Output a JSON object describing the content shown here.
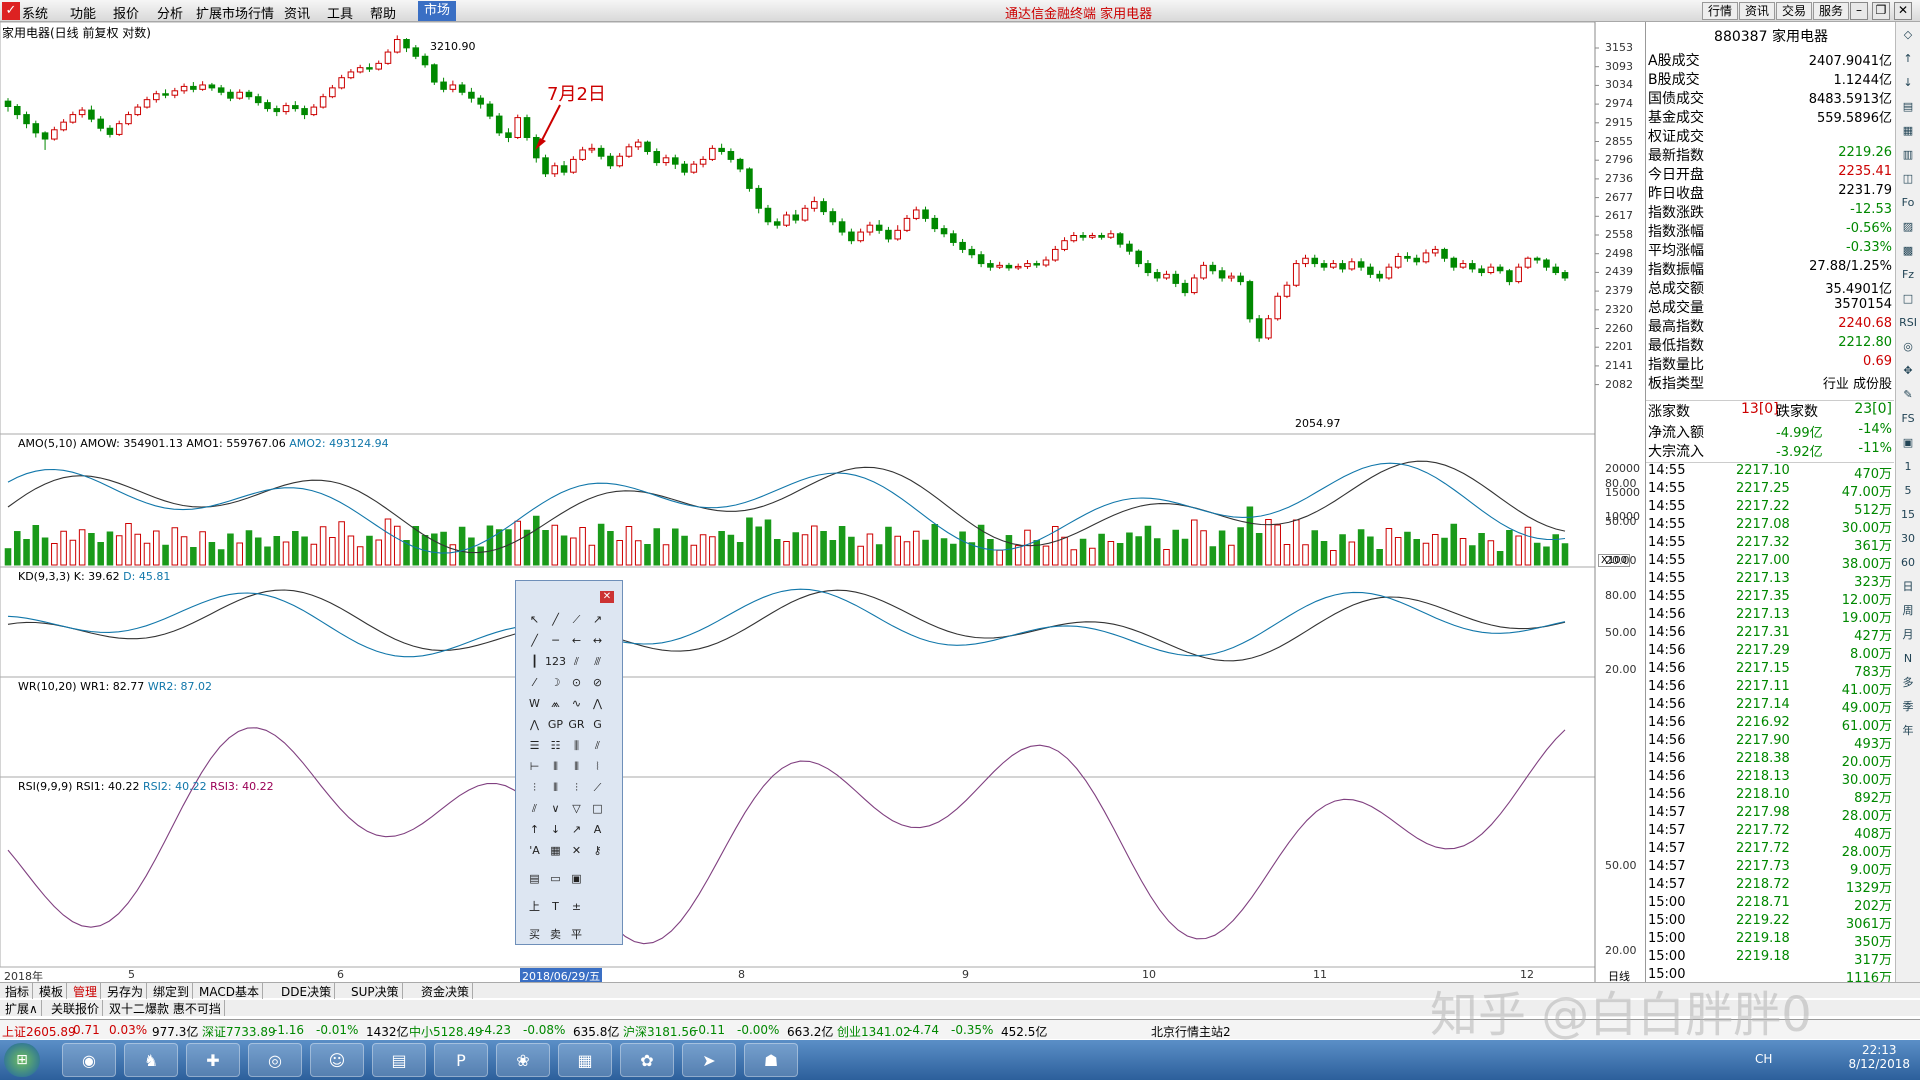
{
  "menubar": {
    "items": [
      "系统",
      "功能",
      "报价",
      "分析",
      "扩展市场行情",
      "资讯",
      "工具",
      "帮助"
    ],
    "active": "市场",
    "title": "通达信金融终端 家用电器",
    "right_buttons": [
      "行情",
      "资讯",
      "交易",
      "服务"
    ]
  },
  "chart": {
    "header": "家用电器(日线 前复权 对数)",
    "annotation": "7月2日",
    "high_label": "3210.90",
    "low_label": "2054.97",
    "y_ticks": [
      "3153",
      "3093",
      "3034",
      "2974",
      "2915",
      "2855",
      "2796",
      "2736",
      "2677",
      "2617",
      "2558",
      "2498",
      "2439",
      "2379",
      "2320",
      "2260",
      "2201",
      "2141",
      "2082"
    ],
    "amo_header": "AMO(5,10) AMOW: 354901.13 AMO1: 559767.06",
    "amo2": "AMO2: 493124.94",
    "amo_ticks": [
      "20000",
      "15000",
      "10000"
    ],
    "amo_unit": "X100",
    "kd_header": "KD(9,3,3) K: 39.62",
    "kd_d": "D: 45.81",
    "wr_header": "WR(10,20) WR1: 82.77",
    "wr_2": "WR2: 87.02",
    "rsi_header": "RSI(9,9,9) RSI1: 40.22",
    "rsi_2": "RSI2: 40.22",
    "rsi_3": "RSI3: 40.22",
    "osc_ticks": [
      "80.00",
      "50.00",
      "20.00"
    ],
    "rsi_ticks": [
      "50.00",
      "20.00"
    ],
    "x_labels": [
      "2018年",
      "5",
      "6",
      "2018/06/29/五",
      "8",
      "9",
      "10",
      "11",
      "12"
    ],
    "period": "日线"
  },
  "candle_data": [
    [
      2980,
      2962,
      2990,
      2945
    ],
    [
      2962,
      2935,
      2970,
      2920
    ],
    [
      2935,
      2905,
      2945,
      2890
    ],
    [
      2905,
      2875,
      2915,
      2860
    ],
    [
      2875,
      2855,
      2880,
      2820
    ],
    [
      2855,
      2885,
      2895,
      2850
    ],
    [
      2885,
      2910,
      2920,
      2880
    ],
    [
      2910,
      2935,
      2945,
      2905
    ],
    [
      2935,
      2950,
      2960,
      2925
    ],
    [
      2950,
      2920,
      2965,
      2910
    ],
    [
      2920,
      2890,
      2930,
      2880
    ],
    [
      2890,
      2870,
      2900,
      2860
    ],
    [
      2870,
      2905,
      2915,
      2865
    ],
    [
      2905,
      2935,
      2945,
      2900
    ],
    [
      2935,
      2960,
      2970,
      2930
    ],
    [
      2960,
      2985,
      2995,
      2955
    ],
    [
      2985,
      3005,
      3015,
      2975
    ],
    [
      3005,
      3000,
      3020,
      2990
    ],
    [
      3000,
      3015,
      3025,
      2990
    ],
    [
      3015,
      3030,
      3040,
      3005
    ],
    [
      3030,
      3020,
      3045,
      3010
    ],
    [
      3020,
      3035,
      3048,
      3015
    ],
    [
      3035,
      3025,
      3042,
      3015
    ],
    [
      3025,
      3010,
      3035,
      3000
    ],
    [
      3010,
      2990,
      3020,
      2980
    ],
    [
      2990,
      3010,
      3020,
      2985
    ],
    [
      3010,
      2995,
      3018,
      2985
    ],
    [
      2995,
      2975,
      3005,
      2965
    ],
    [
      2975,
      2955,
      2985,
      2945
    ],
    [
      2955,
      2945,
      2965,
      2930
    ],
    [
      2945,
      2965,
      2975,
      2935
    ],
    [
      2965,
      2955,
      2980,
      2945
    ],
    [
      2955,
      2935,
      2965,
      2920
    ],
    [
      2935,
      2960,
      2970,
      2930
    ],
    [
      2960,
      2995,
      3005,
      2955
    ],
    [
      2995,
      3025,
      3035,
      2990
    ],
    [
      3025,
      3060,
      3070,
      3020
    ],
    [
      3060,
      3080,
      3090,
      3055
    ],
    [
      3080,
      3095,
      3105,
      3075
    ],
    [
      3095,
      3090,
      3110,
      3080
    ],
    [
      3090,
      3110,
      3120,
      3085
    ],
    [
      3110,
      3150,
      3160,
      3105
    ],
    [
      3150,
      3195,
      3210,
      3145
    ],
    [
      3195,
      3165,
      3200,
      3150
    ],
    [
      3165,
      3135,
      3175,
      3125
    ],
    [
      3135,
      3105,
      3145,
      3095
    ],
    [
      3105,
      3045,
      3110,
      3035
    ],
    [
      3045,
      3020,
      3060,
      3010
    ],
    [
      3020,
      3035,
      3050,
      3010
    ],
    [
      3035,
      3010,
      3045,
      3000
    ],
    [
      3010,
      2990,
      3025,
      2975
    ],
    [
      2990,
      2970,
      3000,
      2955
    ],
    [
      2970,
      2930,
      2980,
      2920
    ],
    [
      2930,
      2875,
      2940,
      2865
    ],
    [
      2875,
      2860,
      2890,
      2845
    ],
    [
      2860,
      2925,
      2935,
      2855
    ],
    [
      2925,
      2860,
      2935,
      2850
    ],
    [
      2860,
      2795,
      2870,
      2780
    ],
    [
      2795,
      2745,
      2805,
      2735
    ],
    [
      2745,
      2770,
      2780,
      2735
    ],
    [
      2770,
      2750,
      2785,
      2740
    ],
    [
      2750,
      2790,
      2800,
      2745
    ],
    [
      2790,
      2820,
      2830,
      2785
    ],
    [
      2820,
      2825,
      2840,
      2810
    ],
    [
      2825,
      2800,
      2835,
      2790
    ],
    [
      2800,
      2770,
      2810,
      2760
    ],
    [
      2770,
      2800,
      2810,
      2765
    ],
    [
      2800,
      2830,
      2840,
      2795
    ],
    [
      2830,
      2845,
      2855,
      2820
    ],
    [
      2845,
      2815,
      2850,
      2805
    ],
    [
      2815,
      2780,
      2825,
      2770
    ],
    [
      2780,
      2795,
      2805,
      2770
    ],
    [
      2795,
      2775,
      2805,
      2760
    ],
    [
      2775,
      2750,
      2785,
      2740
    ],
    [
      2750,
      2775,
      2785,
      2745
    ],
    [
      2775,
      2790,
      2800,
      2765
    ],
    [
      2790,
      2825,
      2835,
      2785
    ],
    [
      2825,
      2815,
      2840,
      2805
    ],
    [
      2815,
      2790,
      2825,
      2780
    ],
    [
      2790,
      2760,
      2795,
      2750
    ],
    [
      2760,
      2700,
      2765,
      2690
    ],
    [
      2700,
      2640,
      2710,
      2625
    ],
    [
      2640,
      2600,
      2650,
      2590
    ],
    [
      2600,
      2590,
      2610,
      2580
    ],
    [
      2590,
      2620,
      2630,
      2585
    ],
    [
      2620,
      2605,
      2635,
      2595
    ],
    [
      2605,
      2640,
      2650,
      2600
    ],
    [
      2640,
      2660,
      2675,
      2630
    ],
    [
      2660,
      2630,
      2670,
      2620
    ],
    [
      2630,
      2600,
      2640,
      2590
    ],
    [
      2600,
      2570,
      2610,
      2560
    ],
    [
      2570,
      2545,
      2580,
      2535
    ],
    [
      2545,
      2570,
      2580,
      2540
    ],
    [
      2570,
      2590,
      2600,
      2560
    ],
    [
      2590,
      2575,
      2605,
      2565
    ],
    [
      2575,
      2550,
      2585,
      2540
    ],
    [
      2550,
      2575,
      2590,
      2545
    ],
    [
      2575,
      2610,
      2620,
      2570
    ],
    [
      2610,
      2635,
      2645,
      2605
    ],
    [
      2635,
      2610,
      2645,
      2600
    ],
    [
      2610,
      2580,
      2620,
      2570
    ],
    [
      2580,
      2565,
      2590,
      2555
    ],
    [
      2565,
      2540,
      2575,
      2530
    ],
    [
      2540,
      2520,
      2550,
      2510
    ],
    [
      2520,
      2505,
      2530,
      2495
    ],
    [
      2505,
      2480,
      2515,
      2470
    ],
    [
      2480,
      2470,
      2490,
      2460
    ],
    [
      2470,
      2475,
      2485,
      2465
    ],
    [
      2475,
      2468,
      2482,
      2460
    ],
    [
      2468,
      2472,
      2480,
      2462
    ],
    [
      2472,
      2480,
      2490,
      2465
    ],
    [
      2480,
      2476,
      2488,
      2468
    ],
    [
      2476,
      2490,
      2500,
      2470
    ],
    [
      2490,
      2520,
      2530,
      2485
    ],
    [
      2520,
      2545,
      2555,
      2515
    ],
    [
      2545,
      2560,
      2570,
      2540
    ],
    [
      2560,
      2555,
      2570,
      2545
    ],
    [
      2555,
      2560,
      2568,
      2550
    ],
    [
      2560,
      2555,
      2568,
      2548
    ],
    [
      2555,
      2565,
      2575,
      2550
    ],
    [
      2565,
      2535,
      2570,
      2525
    ],
    [
      2535,
      2515,
      2545,
      2505
    ],
    [
      2515,
      2480,
      2520,
      2470
    ],
    [
      2480,
      2455,
      2490,
      2445
    ],
    [
      2455,
      2440,
      2465,
      2430
    ],
    [
      2440,
      2450,
      2460,
      2435
    ],
    [
      2450,
      2425,
      2460,
      2415
    ],
    [
      2425,
      2400,
      2435,
      2390
    ],
    [
      2400,
      2440,
      2450,
      2395
    ],
    [
      2440,
      2475,
      2485,
      2435
    ],
    [
      2475,
      2460,
      2485,
      2450
    ],
    [
      2460,
      2440,
      2470,
      2430
    ],
    [
      2440,
      2445,
      2455,
      2430
    ],
    [
      2445,
      2430,
      2455,
      2420
    ],
    [
      2430,
      2330,
      2435,
      2320
    ],
    [
      2330,
      2280,
      2340,
      2270
    ],
    [
      2280,
      2330,
      2340,
      2275
    ],
    [
      2330,
      2390,
      2400,
      2325
    ],
    [
      2390,
      2420,
      2430,
      2385
    ],
    [
      2420,
      2480,
      2490,
      2415
    ],
    [
      2480,
      2495,
      2505,
      2470
    ],
    [
      2495,
      2480,
      2505,
      2470
    ],
    [
      2480,
      2470,
      2490,
      2460
    ],
    [
      2470,
      2480,
      2490,
      2465
    ],
    [
      2480,
      2465,
      2490,
      2455
    ],
    [
      2465,
      2485,
      2495,
      2460
    ],
    [
      2485,
      2470,
      2495,
      2460
    ],
    [
      2470,
      2450,
      2480,
      2440
    ],
    [
      2450,
      2440,
      2460,
      2430
    ],
    [
      2440,
      2470,
      2480,
      2435
    ],
    [
      2470,
      2500,
      2510,
      2465
    ],
    [
      2500,
      2495,
      2512,
      2485
    ],
    [
      2495,
      2485,
      2505,
      2475
    ],
    [
      2485,
      2510,
      2520,
      2480
    ],
    [
      2510,
      2520,
      2530,
      2500
    ],
    [
      2520,
      2495,
      2525,
      2485
    ],
    [
      2495,
      2470,
      2500,
      2460
    ],
    [
      2470,
      2480,
      2490,
      2465
    ],
    [
      2480,
      2465,
      2490,
      2455
    ],
    [
      2465,
      2455,
      2475,
      2445
    ],
    [
      2455,
      2470,
      2480,
      2450
    ],
    [
      2470,
      2460,
      2478,
      2452
    ],
    [
      2460,
      2430,
      2465,
      2420
    ],
    [
      2430,
      2470,
      2480,
      2425
    ],
    [
      2470,
      2495,
      2500,
      2465
    ],
    [
      2495,
      2490,
      2500,
      2480
    ],
    [
      2490,
      2470,
      2495,
      2460
    ],
    [
      2470,
      2455,
      2480,
      2448
    ],
    [
      2455,
      2440,
      2462,
      2432
    ]
  ],
  "right_panel": {
    "code_name": "880387 家用电器",
    "stats": [
      {
        "k": "A股成交",
        "v": "2407.9041亿",
        "c": "#000"
      },
      {
        "k": "B股成交",
        "v": "1.1244亿",
        "c": "#000"
      },
      {
        "k": "国债成交",
        "v": "8483.5913亿",
        "c": "#000"
      },
      {
        "k": "基金成交",
        "v": "559.5896亿",
        "c": "#000"
      },
      {
        "k": "权证成交",
        "v": "",
        "c": "#000"
      },
      {
        "k": "最新指数",
        "v": "2219.26",
        "c": "#080"
      },
      {
        "k": "今日开盘",
        "v": "2235.41",
        "c": "#c00"
      },
      {
        "k": "昨日收盘",
        "v": "2231.79",
        "c": "#000"
      },
      {
        "k": "指数涨跌",
        "v": "-12.53",
        "c": "#080"
      },
      {
        "k": "指数涨幅",
        "v": "-0.56%",
        "c": "#080"
      },
      {
        "k": "平均涨幅",
        "v": "-0.33%",
        "c": "#080"
      },
      {
        "k": "指数振幅",
        "v": "27.88/1.25%",
        "c": "#000"
      },
      {
        "k": "总成交额",
        "v": "35.4901亿",
        "c": "#000"
      },
      {
        "k": "总成交量",
        "v": "3570154",
        "c": "#000"
      },
      {
        "k": "最高指数",
        "v": "2240.68",
        "c": "#c00"
      },
      {
        "k": "最低指数",
        "v": "2212.80",
        "c": "#080"
      },
      {
        "k": "指数量比",
        "v": "0.69",
        "c": "#c00"
      },
      {
        "k": "板指类型",
        "v": "行业 成份股",
        "c": "#000"
      }
    ],
    "updown": {
      "up_label": "涨家数",
      "up_val": "13[0]",
      "down_label": "跌家数",
      "down_val": "23[0]"
    },
    "flows": [
      {
        "k": "净流入额",
        "v": "-4.99亿",
        "p": "-14%"
      },
      {
        "k": "大宗流入",
        "v": "-3.92亿",
        "p": "-11%"
      }
    ],
    "ticks": [
      [
        "14:55",
        "2217.10",
        "470万"
      ],
      [
        "14:55",
        "2217.25",
        "47.00万"
      ],
      [
        "14:55",
        "2217.22",
        "512万"
      ],
      [
        "14:55",
        "2217.08",
        "30.00万"
      ],
      [
        "14:55",
        "2217.32",
        "361万"
      ],
      [
        "14:55",
        "2217.00",
        "38.00万"
      ],
      [
        "14:55",
        "2217.13",
        "323万"
      ],
      [
        "14:55",
        "2217.35",
        "12.00万"
      ],
      [
        "14:56",
        "2217.13",
        "19.00万"
      ],
      [
        "14:56",
        "2217.31",
        "427万"
      ],
      [
        "14:56",
        "2217.29",
        "8.00万"
      ],
      [
        "14:56",
        "2217.15",
        "783万"
      ],
      [
        "14:56",
        "2217.11",
        "41.00万"
      ],
      [
        "14:56",
        "2217.14",
        "49.00万"
      ],
      [
        "14:56",
        "2216.92",
        "61.00万"
      ],
      [
        "14:56",
        "2217.90",
        "493万"
      ],
      [
        "14:56",
        "2218.38",
        "20.00万"
      ],
      [
        "14:56",
        "2218.13",
        "30.00万"
      ],
      [
        "14:56",
        "2218.10",
        "892万"
      ],
      [
        "14:57",
        "2217.98",
        "28.00万"
      ],
      [
        "14:57",
        "2217.72",
        "408万"
      ],
      [
        "14:57",
        "2217.72",
        "28.00万"
      ],
      [
        "14:57",
        "2217.73",
        "9.00万"
      ],
      [
        "14:57",
        "2218.72",
        "1329万"
      ],
      [
        "15:00",
        "2218.71",
        "202万"
      ],
      [
        "15:00",
        "2219.22",
        "3061万"
      ],
      [
        "15:00",
        "2219.18",
        "350万"
      ],
      [
        "15:00",
        "2219.18",
        "317万"
      ],
      [
        "15:00",
        "",
        "1116万"
      ]
    ]
  },
  "right_strip": [
    "◇",
    "↑",
    "↓",
    "▤",
    "▦",
    "▥",
    "◫",
    "Fo",
    "▨",
    "▩",
    "Fz",
    "□",
    "RSI",
    "◎",
    "✥",
    "✎",
    "FS",
    "▣",
    "1",
    "5",
    "15",
    "30",
    "60",
    "日",
    "周",
    "月",
    "N",
    "多",
    "季",
    "年"
  ],
  "toolpanel": {
    "close": "✕",
    "tools": [
      "↖",
      "╱",
      "⟋",
      "↗",
      "╱",
      "─",
      "←",
      "↔",
      "┃",
      "123",
      "⫽",
      "⫻",
      "⁄",
      "☽",
      "⊙",
      "⊘",
      "W",
      "⩕",
      "∿",
      "⋀",
      "⋀",
      "GP",
      "GR",
      "G",
      "☰",
      "☷",
      "⫼",
      "⫽",
      "⊢",
      "⦀",
      "⫴",
      "⦚",
      "⫶",
      "⦀",
      "⫶",
      "⟋",
      "⫽",
      "∨",
      "▽",
      "□",
      "↑",
      "↓",
      "↗",
      "A",
      "'A",
      "▦",
      "✕",
      "⚷",
      "▤",
      "▭",
      "▣",
      "",
      "上",
      "T",
      "±",
      "",
      "买",
      "卖",
      "平",
      ""
    ]
  },
  "bottom_tabs": [
    "指标",
    "模板",
    "管理",
    "另存为",
    "绑定到",
    "MACD基本",
    "DDE决策",
    "SUP决策",
    "资金决策"
  ],
  "bottom_tabs2": [
    "扩展∧",
    "关联报价",
    "双十二爆款 惠不可挡"
  ],
  "indexbar": [
    {
      "t": "上证2605.89",
      "c": "#c00"
    },
    {
      "t": "0.71",
      "c": "#c00"
    },
    {
      "t": "0.03%",
      "c": "#c00"
    },
    {
      "t": "977.3亿",
      "c": "#000"
    },
    {
      "t": "深证7733.89",
      "c": "#080"
    },
    {
      "t": "-1.16",
      "c": "#080"
    },
    {
      "t": "-0.01%",
      "c": "#080"
    },
    {
      "t": "1432亿",
      "c": "#000"
    },
    {
      "t": "中小5128.49",
      "c": "#080"
    },
    {
      "t": "-4.23",
      "c": "#080"
    },
    {
      "t": "-0.08%",
      "c": "#080"
    },
    {
      "t": "635.8亿",
      "c": "#000"
    },
    {
      "t": "沪深3181.56",
      "c": "#080"
    },
    {
      "t": "-0.11",
      "c": "#080"
    },
    {
      "t": "-0.00%",
      "c": "#080"
    },
    {
      "t": "663.2亿",
      "c": "#000"
    },
    {
      "t": "创业1341.02",
      "c": "#080"
    },
    {
      "t": "-4.74",
      "c": "#080"
    },
    {
      "t": "-0.35%",
      "c": "#080"
    },
    {
      "t": "452.5亿",
      "c": "#000"
    },
    {
      "t": "北京行情主站2",
      "c": "#000"
    }
  ],
  "taskbar": {
    "apps": [
      "◉",
      "♞",
      "✚",
      "◎",
      "☺",
      "▤",
      "P",
      "❀",
      "▦",
      "✿",
      "➤",
      "☗"
    ],
    "clock_time": "22:13",
    "clock_date": "8/12/2018",
    "tray": "CH"
  },
  "watermark": "知乎 @白白胖胖0"
}
